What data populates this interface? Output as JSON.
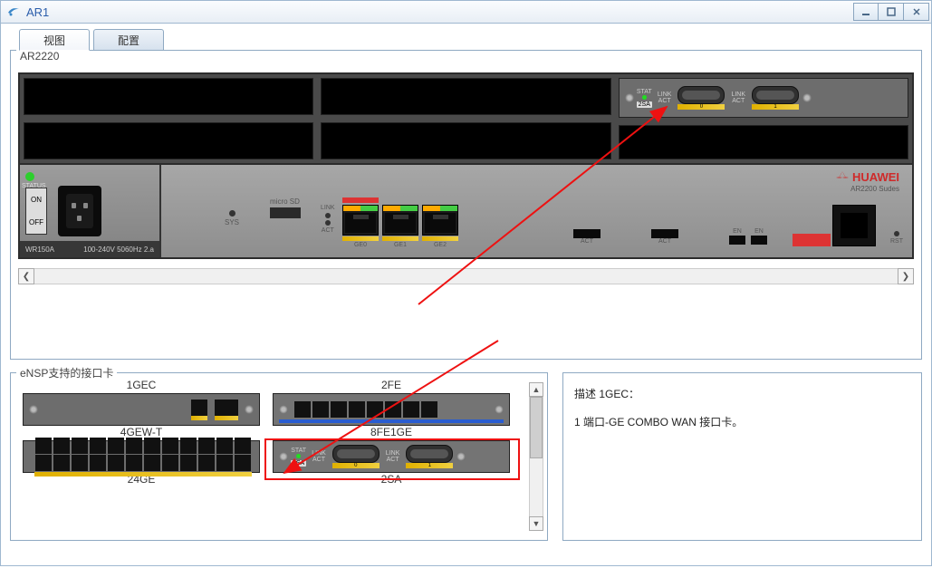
{
  "titlebar": {
    "title": "AR1"
  },
  "tabs": {
    "view": "视图",
    "config": "配置"
  },
  "device": {
    "model": "AR2220",
    "brand": "HUAWEI",
    "brand_sub": "AR2200 Sudes",
    "psu_model": "WR150A",
    "psu_spec": "100-240V  5060Hz 2.a",
    "on": "ON",
    "off": "OFF",
    "status": "STATUS",
    "sys": "SYS",
    "microsd": "micro SD",
    "link": "LINK",
    "act": "ACT",
    "ge0": "GE0",
    "ge1": "GE1",
    "ge2": "GE2",
    "en": "EN",
    "rst": "RST",
    "card2sa": {
      "stat": "STAT",
      "link": "LINK",
      "act": "ACT",
      "badge": "2SA",
      "p0": "0",
      "p1": "1"
    }
  },
  "cards_panel": {
    "legend": "eNSP支持的接口卡",
    "items": [
      {
        "title": "1GEC"
      },
      {
        "title": "2FE"
      },
      {
        "title": "4GEW-T"
      },
      {
        "title": "8FE1GE"
      },
      {
        "title": "24GE"
      },
      {
        "title": "2SA"
      }
    ]
  },
  "description": {
    "title": "描述 1GEC：",
    "body": "1 端口-GE COMBO WAN 接口卡。"
  }
}
